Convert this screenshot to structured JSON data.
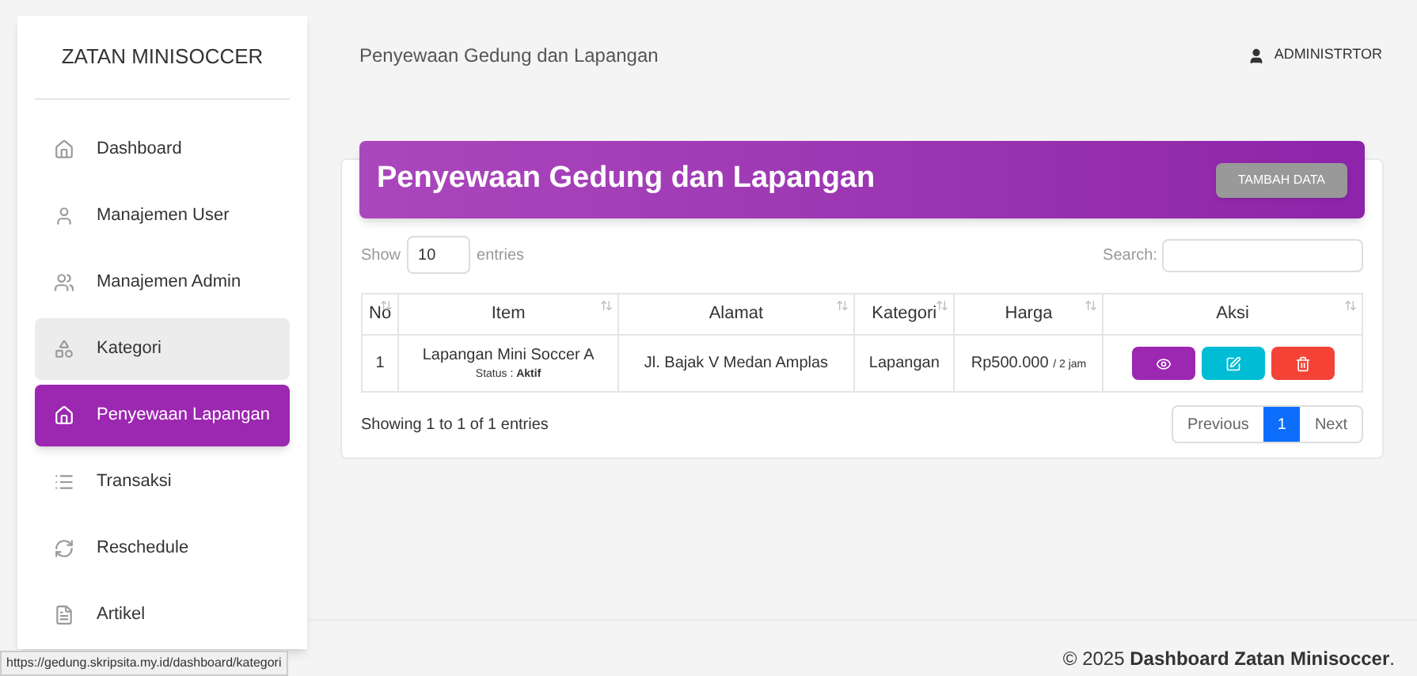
{
  "sidebar": {
    "brand": "ZATAN MINISOCCER",
    "items": [
      {
        "label": "Dashboard",
        "selected": false,
        "highlighted": false
      },
      {
        "label": "Manajemen User",
        "selected": false,
        "highlighted": false
      },
      {
        "label": "Manajemen Admin",
        "selected": false,
        "highlighted": false
      },
      {
        "label": "Kategori",
        "selected": false,
        "highlighted": true
      },
      {
        "label": "Penyewaan Lapangan",
        "selected": true,
        "highlighted": false
      },
      {
        "label": "Transaksi",
        "selected": false,
        "highlighted": false
      },
      {
        "label": "Reschedule",
        "selected": false,
        "highlighted": false
      },
      {
        "label": "Artikel",
        "selected": false,
        "highlighted": false
      }
    ]
  },
  "header": {
    "breadcrumb": "Penyewaan Gedung dan Lapangan",
    "user": "ADMINISTRTOR"
  },
  "card": {
    "title": "Penyewaan Gedung dan Lapangan",
    "add_button": "TAMBAH DATA",
    "length": {
      "label_before": "Show",
      "value": "10",
      "label_after": "entries"
    },
    "search": {
      "label": "Search:"
    },
    "columns": [
      "No",
      "Item",
      "Alamat",
      "Kategori",
      "Harga",
      "Aksi"
    ],
    "rows": [
      {
        "no": "1",
        "item": "Lapangan Mini Soccer A",
        "status": "Status : **Aktif**",
        "alamat": "Jl. Bajak V Medan Amplas",
        "kategori": "Lapangan",
        "harga": "Rp500.000",
        "per": "/ 2 jam"
      }
    ],
    "info": "Showing 1 to 1 of 1 entries",
    "pagination": [
      {
        "label": "Previous",
        "selected": false
      },
      {
        "label": "1",
        "selected": true
      },
      {
        "label": "Next",
        "selected": false
      }
    ]
  },
  "footer": {
    "text": "© 2025 **Dashboard Zatan Minisoccer**."
  },
  "status_url": "https://gedung.skripsita.my.id/dashboard/kategori"
}
